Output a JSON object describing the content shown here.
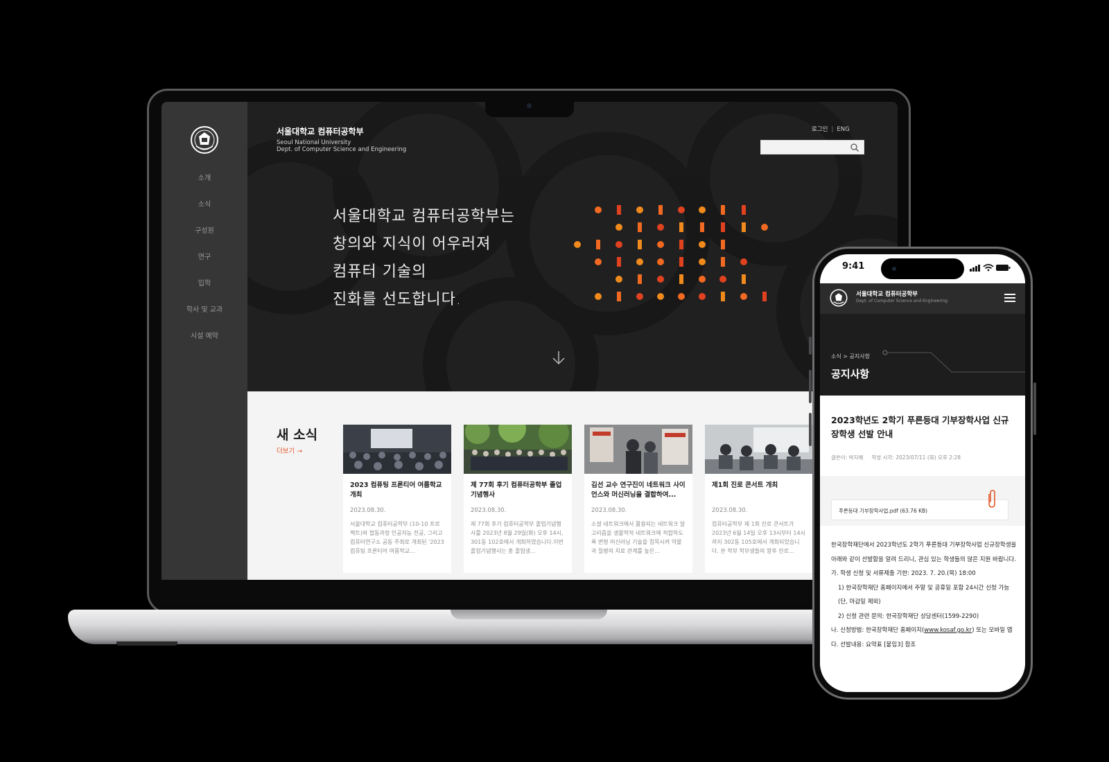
{
  "laptop": {
    "sidebar": {
      "items": [
        "소개",
        "소식",
        "구성원",
        "연구",
        "입학",
        "학사 및 교과",
        "시설 예약"
      ]
    },
    "header": {
      "title": "서울대학교 컴퓨터공학부",
      "subtitle_line1": "Seoul National University",
      "subtitle_line2": "Dept. of Computer Science and Engineering",
      "login": "로그인",
      "lang": "ENG",
      "search_placeholder": ""
    },
    "hero": {
      "lines": [
        "서울대학교 컴퓨터공학부는",
        "창의와 지식이 어우러져",
        "컴퓨터 기술의",
        "진화를 선도합니다."
      ]
    },
    "news": {
      "title": "새 소식",
      "more": "더보기",
      "cards": [
        {
          "title": "2023 컴퓨팅 프론티어 여름학교 개최",
          "date": "2023.08.30.",
          "desc": "서울대학교 컴퓨터공학부 (10-10 프로젝트)와 협동과정 인공지능 전공, 그리고 컴퓨터연구소 공동 주최로 개최된 '2023 컴퓨팅 프론티어 여름학교..."
        },
        {
          "title": "제 77회 후기 컴퓨터공학부 졸업기념행사",
          "date": "2023.08.30.",
          "desc": "제 77회 후기 컴퓨터공학부 졸업기념행사를 2023년 8월 29일(화) 오후 14시, 301동 102호에서 개최하였습니다.이번 졸업기념행사는 총 졸업생..."
        },
        {
          "title": "김선 교수 연구진이 네트워크 사이언스와 머신러닝을 결합하여...",
          "date": "2023.08.30.",
          "desc": "소셜 네트워크에서 활용되는 네트워크 알고리즘을 생물학적 네트워크에 적합하도록 변형 머신러닝 기술을 접목시켜 약물과 질병의 치료 관계를 높은..."
        },
        {
          "title": "제1회 진로 콘서트 개최",
          "date": "2023.08.30.",
          "desc": "컴퓨터공학부 제 1회 진로 콘서트가 2023년 6월 14일 오후 13시부터 14시까지 302동 105호에서 개최되었습니다. 본 학부 학부생들의 향후 진로..."
        }
      ]
    }
  },
  "phone": {
    "status_time": "9:41",
    "header_title": "서울대학교 컴퓨터공학부",
    "header_sub": "Dept. of Computer Science and Engineering",
    "breadcrumb": "소식 > 공지사항",
    "page_title": "공지사항",
    "post": {
      "title": "2023학년도 2학기 푸른등대 기부장학사업 신규장학생 선발 안내",
      "author": "글쓴이: 박지예",
      "written": "작성 시각: 2023/07/11 (화) 오후 2:28",
      "attachment": "푸른등대 기부장학사업.pdf (63.76 KB)",
      "body": [
        "한국장학재단에서 2023학년도 2학기 푸른등대 기부장학사업 신규장학생을 아래와 같이 선발함을 알려 드리니, 관심 있는 학생들의 많은 지원 바랍니다.",
        "가. 학생 신청 및 서류제출 기한: 2023. 7. 20.(목) 18:00",
        "1) 한국장학재단 홈페이지에서 주말 및 공휴일 포함 24시간 신청 가능(단, 마감일 제외)",
        "2) 신청 관련 문의: 한국장학재단 상담센터(1599-2290)",
        "나. 신청방법: 한국장학재단 홈페이지(",
        "www.kosaf.go.kr",
        ") 또는 모바일 앱",
        "다. 선발내용: 요약표 [붙임3] 참조"
      ]
    }
  },
  "colors": {
    "accent": "#e2582b",
    "dot_orange": "#f26a21",
    "dot_red": "#e0421f",
    "dot_yellow": "#f08a1c"
  }
}
